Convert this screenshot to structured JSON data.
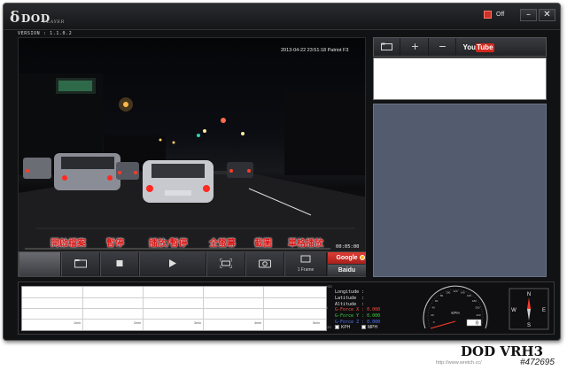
{
  "window": {
    "logo_text": "DOD",
    "logo_sub": "PLAYER",
    "off_label": "Off",
    "min_label": "–",
    "close_label": "✕"
  },
  "version": "VERSION : 1.1.0.2",
  "video": {
    "osd_datetime": "2013-04-22 23:51:18 Patriot F3",
    "counter": "00:05:00"
  },
  "captions": {
    "open_file": "開啟檔案",
    "pause": "暫停",
    "play_pause": "播放/暫停",
    "fullscreen": "全螢幕",
    "screenshot": "截圖",
    "frame_step": "單格播放"
  },
  "controls": {
    "frame_label": "1 Frame",
    "google_label": "Google",
    "baidu_label": "Baidu"
  },
  "side": {
    "youtube_you": "You",
    "youtube_tube": "Tube"
  },
  "graph": {
    "ticks": [
      "1min",
      "2min",
      "3min",
      "4min",
      "5min"
    ],
    "yscale": [
      "+2G",
      "0",
      "-2G"
    ]
  },
  "readouts": {
    "longitude": "Longitude :",
    "latitude": "Latitude  :",
    "altitude": "Altitude  :",
    "gx": "G-Force X : 0.000",
    "gy": "G-Force Y : 0.000",
    "gz": "G-Force Z : 0.000",
    "kph": "KPH",
    "mph": "MPH"
  },
  "speedometer": {
    "unit": "KPH",
    "value": "0",
    "scale": [
      "0",
      "20",
      "40",
      "60",
      "80",
      "100",
      "120",
      "140",
      "160",
      "180",
      "200",
      "220",
      "240"
    ]
  },
  "compass": {
    "n": "N",
    "s": "S",
    "e": "E",
    "w": "W"
  },
  "footer": {
    "brand": "DOD VRH3",
    "watermark": "http://www.wretch.cc/",
    "photo_id": "#472695"
  },
  "colors": {
    "accent_red": "#d12a1f",
    "caption_red": "#d81a1a",
    "map_panel": "#535c6e",
    "gx": "#ff5040",
    "gy": "#3cd43c",
    "gz": "#4f79ff"
  }
}
